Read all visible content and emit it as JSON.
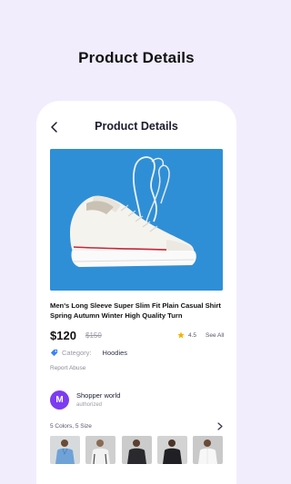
{
  "banner": {
    "title": "Product Details"
  },
  "header": {
    "title": "Product Details",
    "back_icon": "chevron-left-icon"
  },
  "product": {
    "image_icon": "sneaker-image",
    "name": "Men's Long Sleeve Super Slim Fit Plain Casual Shirt Spring Autumn Winter High Quality Turn",
    "price": "$120",
    "old_price": "$150",
    "rating": "4.5",
    "see_all": "See All",
    "category_label": "Category:",
    "category_value": "Hoodies",
    "report": "Report Abuse"
  },
  "seller": {
    "initial": "M",
    "name": "Shopper world",
    "status": "authorized"
  },
  "variants": {
    "summary": "5 Colors, 5 Size",
    "thumbnails": [
      "model-white-shirt",
      "model-gray-shirt",
      "model-black-shirt",
      "model-black-shirt-2",
      "model-white-shirt-2"
    ]
  },
  "colors": {
    "background": "#f1edfd",
    "accent": "#7c3cf2",
    "hero_bg": "#2f8fd6",
    "star": "#f5b301"
  }
}
